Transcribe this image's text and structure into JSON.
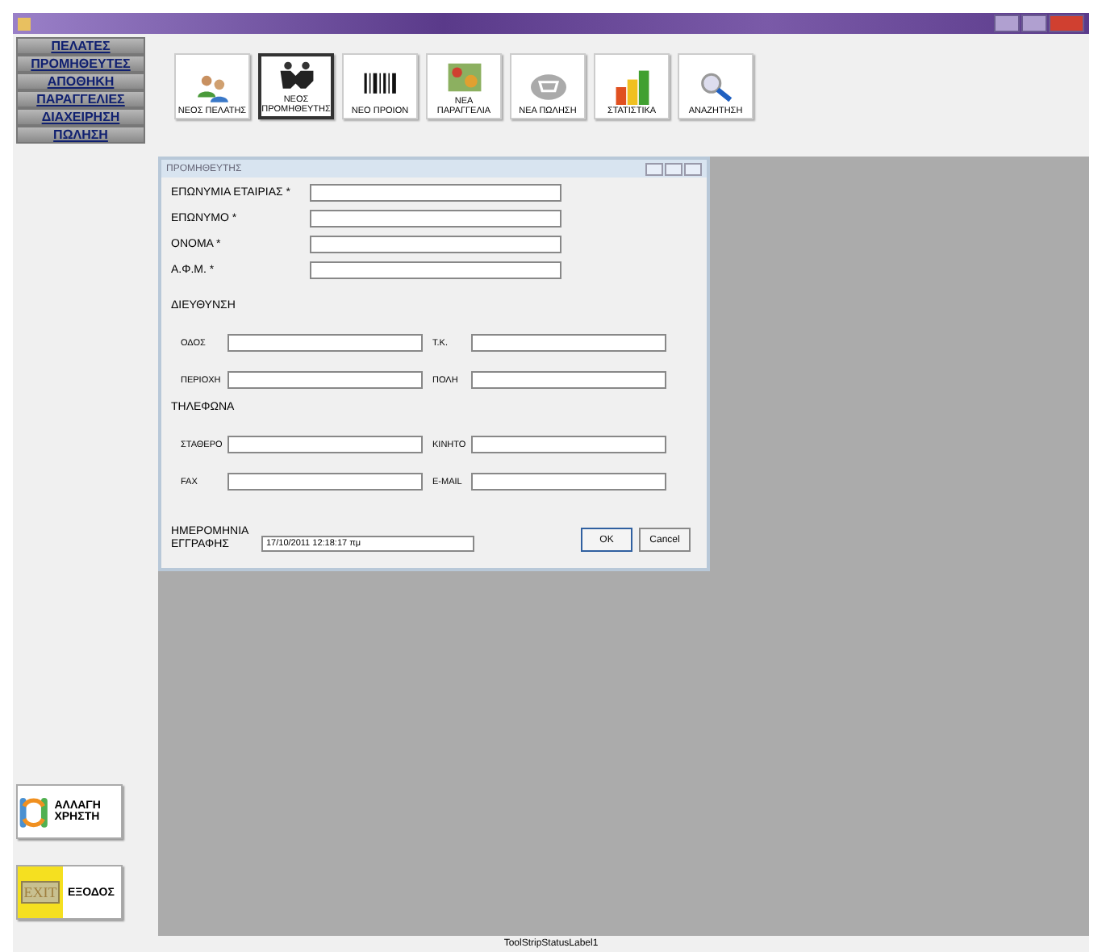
{
  "menu": [
    {
      "label": "ΠΕΛΑΤΕΣ"
    },
    {
      "label": "ΠΡΟΜΗΘΕΥΤΕΣ"
    },
    {
      "label": "ΑΠΟΘΗΚΗ"
    },
    {
      "label": "ΠΑΡΑΓΓΕΛΙΕΣ"
    },
    {
      "label": "ΔΙΑΧΕΙΡΗΣΗ"
    },
    {
      "label": "ΠΩΛΗΣΗ"
    }
  ],
  "toolbar": [
    {
      "kind": "people",
      "label": "ΝΕΟΣ ΠΕΛΑΤΗΣ",
      "selected": false
    },
    {
      "kind": "handshake",
      "label": "ΝΕΟΣ ΠΡΟΜΗΘΕΥΤΗΣ",
      "selected": true
    },
    {
      "kind": "barcode",
      "label": "ΝΕΟ ΠΡΟΙΟΝ",
      "selected": false
    },
    {
      "kind": "produce",
      "label": "ΝΕΑ ΠΑΡΑΓΓΕΛΙΑ",
      "selected": false
    },
    {
      "kind": "cart",
      "label": "ΝΕΑ ΠΩΛΗΣΗ",
      "selected": false
    },
    {
      "kind": "chart",
      "label": "ΣΤΑΤΙΣΤΙΚΑ",
      "selected": false
    },
    {
      "kind": "search",
      "label": "ΑΝΑΖΗΤΗΣΗ",
      "selected": false
    }
  ],
  "dialog": {
    "title": "ΠΡΟΜΗΘΕΥΤΗΣ",
    "fields": [
      {
        "label": "ΕΠΩΝΥΜΙΑ ΕΤΑΙΡΙΑΣ *"
      },
      {
        "label": "ΕΠΩΝΥΜΟ *"
      },
      {
        "label": "ΟΝΟΜΑ *"
      },
      {
        "label": "Α.Φ.Μ. *"
      }
    ],
    "sections": [
      {
        "title": "ΔΙΕΥΘΥΝΣΗ",
        "fields": [
          {
            "label": "ΟΔΟΣ"
          },
          {
            "label": "Τ.Κ."
          },
          {
            "label": "ΠΕΡΙΟΧΗ"
          },
          {
            "label": "ΠΟΛΗ"
          }
        ]
      },
      {
        "title": "ΤΗΛΕΦΩΝΑ",
        "fields": [
          {
            "label": "ΣΤΑΘΕΡΟ"
          },
          {
            "label": "ΚΙΝΗΤΟ"
          },
          {
            "label": "FAX"
          },
          {
            "label": "E-MAIL"
          }
        ]
      }
    ],
    "date_label": "ΗΜΕΡΟΜΗΝΙΑ ΕΓΓΡΑΦΗΣ",
    "date_value": "17/10/2011 12:18:17 πμ",
    "buttons": [
      "OK",
      "Cancel"
    ]
  },
  "side_buttons": [
    {
      "kind": "switch-user",
      "label": "ΑΛΛΑΓΗ ΧΡΗΣΤΗ"
    },
    {
      "kind": "exit",
      "label": "ΕΞΟΔΟΣ",
      "icon_text": "EXIT"
    }
  ],
  "status_bar": "ToolStripStatusLabel1"
}
